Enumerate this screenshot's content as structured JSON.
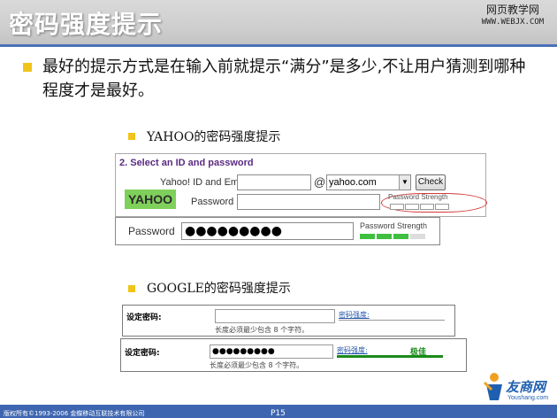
{
  "slide": {
    "title": "密码强度提示",
    "watermark_line1": "网页教学网",
    "watermark_line2": "WWW.WEBJX.COM",
    "main_text": "最好的提示方式是在输入前就提示“满分”是多少,不让用户猜测到哪种程度才是最好。",
    "yahoo_heading": "YAHOO的密码强度提示",
    "google_heading": "GOOGLE的密码强度提示",
    "page_number": "P15",
    "copyright": "版权所有©1993-2006 金蝶移动互联技术有限公司",
    "logo_text": "友商网",
    "logo_url": "Youshang.com"
  },
  "yahoo": {
    "section_heading": "2. Select an ID and password",
    "id_label": "Yahoo! ID and Email",
    "at_sign": "@",
    "domain_value": "yahoo.com",
    "check_label": "Check",
    "password_label": "Password",
    "strength_label": "Password Strength",
    "logo": "YAHOO",
    "filled_password_label": "Password",
    "filled_password_mask": "●●●●●●●●●",
    "filled_strength_label": "Password Strength",
    "filled_strength_fraction": 0.75
  },
  "google": {
    "row1": {
      "label": "设定密码:",
      "strength_link": "密码强度:",
      "hint": "长度必须最少包含 8 个字符。"
    },
    "row2": {
      "label": "设定密码:",
      "mask": "●●●●●●●●●",
      "strength_link": "密码强度:",
      "strength_value": "极佳",
      "hint": "长度必须最少包含 8 个字符。"
    }
  },
  "colors": {
    "title_bar": "#cfcfcf",
    "accent_blue": "#3e66b0",
    "bullet": "#f0c419",
    "yahoo_green": "#7fd05b",
    "strength_green": "#3fbf3f",
    "google_strength_good": "#1a8a1a"
  }
}
